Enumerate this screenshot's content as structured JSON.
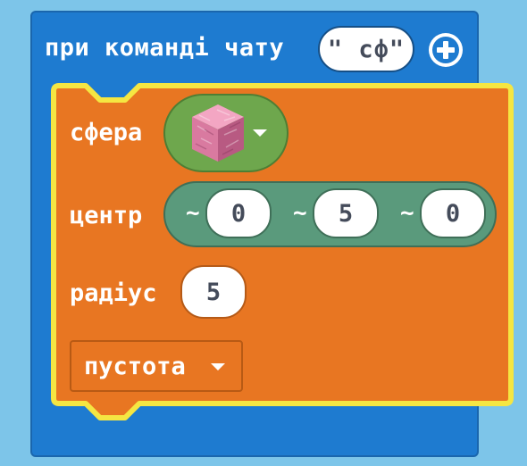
{
  "event_block": {
    "label": "при команді чату",
    "command_value": "\" сф\"",
    "add_icon": "plus-circle-icon",
    "color": "#1e7bd0"
  },
  "sphere_block": {
    "label": "сфера",
    "color": "#e87622",
    "highlight": "#f5e642",
    "block_dropdown": {
      "icon": "pink-wool-cube-icon",
      "color": "#6ea74d"
    },
    "center": {
      "label": "центр",
      "color": "#5a9a7c",
      "tilde": "~",
      "x": "0",
      "y": "5",
      "z": "0"
    },
    "radius": {
      "label": "радіус",
      "value": "5"
    },
    "mode": {
      "selected": "пустота"
    }
  }
}
